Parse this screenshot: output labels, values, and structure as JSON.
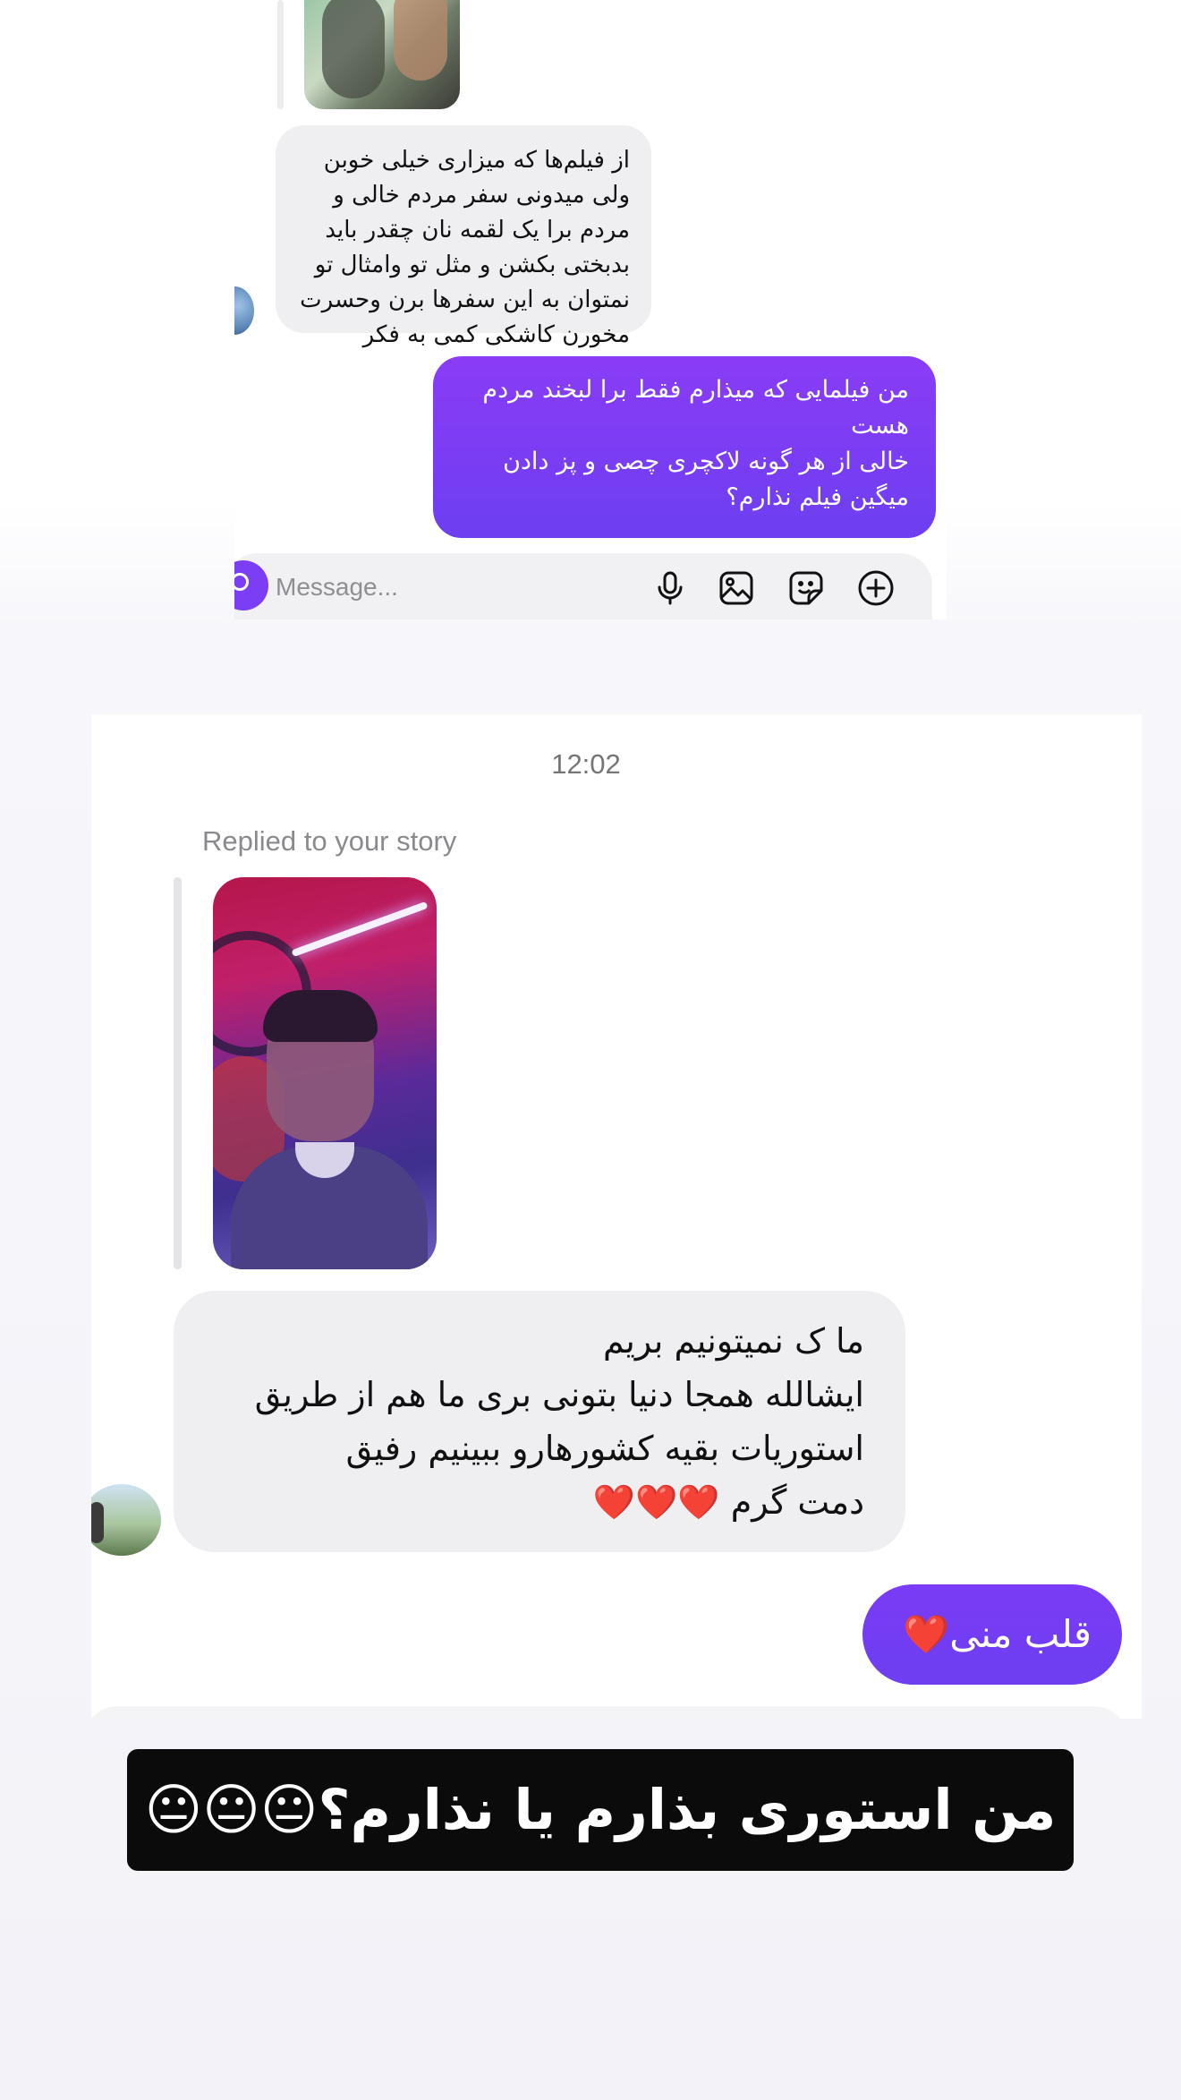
{
  "top_screenshot": {
    "incoming_message": "از فیلم‌ها که میزاری خیلی خوبن ولی میدونی سفر مردم خالی و مردم برا یک لقمه نان چقدر باید بدبختی بکشن و مثل تو وامثال تو نمتوان به این سفرها برن  وحسرت مخورن کاشکی کمی به فکر جوان‌ها بودی",
    "outgoing_message": "من فیلمایی که میذارم فقط برا لبخند مردم هست\nخالی از هر گونه لاکچری چصی و پز دادن میگین فیلم نذارم؟",
    "composer": {
      "placeholder": "Message...",
      "icons": [
        "camera-icon",
        "microphone-icon",
        "gallery-icon",
        "sticker-icon",
        "plus-circle-icon"
      ]
    }
  },
  "bottom_screenshot": {
    "timestamp": "12:02",
    "replied_label": "Replied to your story",
    "incoming_message": "ما ک نمیتونیم بریم\nایشالله همجا دنیا بتونی بری ما هم از طریق استوریات بقیه کشورهارو ببینیم رفیق\nدمت گرم ❤️❤️❤️",
    "outgoing_message": "قلب منی❤️"
  },
  "caption": "من استوری بذارم یا نذارم؟😐😐😐",
  "colors": {
    "outgoing_bubble": "#7a3cf6",
    "incoming_bubble": "#efeff2",
    "caption_bg": "#0b0b0b"
  }
}
